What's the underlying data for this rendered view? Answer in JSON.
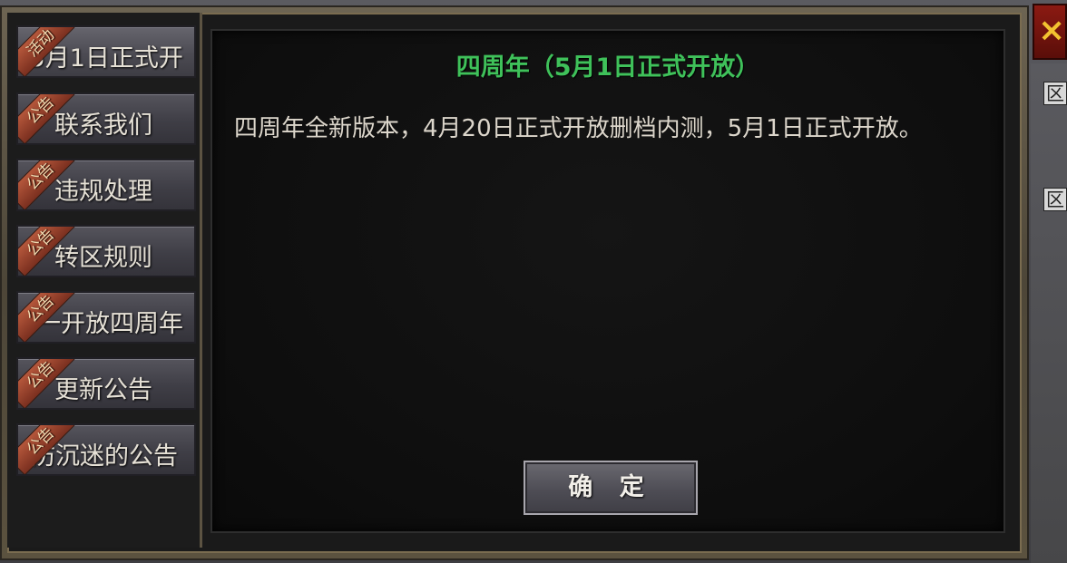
{
  "tabs": [
    {
      "badge": "活动",
      "label": "(5月1日正式开",
      "active": true
    },
    {
      "badge": "公告",
      "label": "联系我们"
    },
    {
      "badge": "公告",
      "label": "违规处理"
    },
    {
      "badge": "公告",
      "label": "转区规则"
    },
    {
      "badge": "公告",
      "label": "一开放四周年"
    },
    {
      "badge": "公告",
      "label": "更新公告"
    },
    {
      "badge": "公告",
      "label": "防沉迷的公告"
    }
  ],
  "notice": {
    "title": "四周年（5月1日正式开放）",
    "body": "四周年全新版本，4月20日正式开放删档内测，5月1日正式开放。"
  },
  "confirm_label": "确 定",
  "close_icon": "×",
  "side_boxes": [
    "区",
    "区"
  ],
  "colors": {
    "title_green": "#3fc15a",
    "badge_red": "#b5573b",
    "close_red": "#8b1a12"
  }
}
